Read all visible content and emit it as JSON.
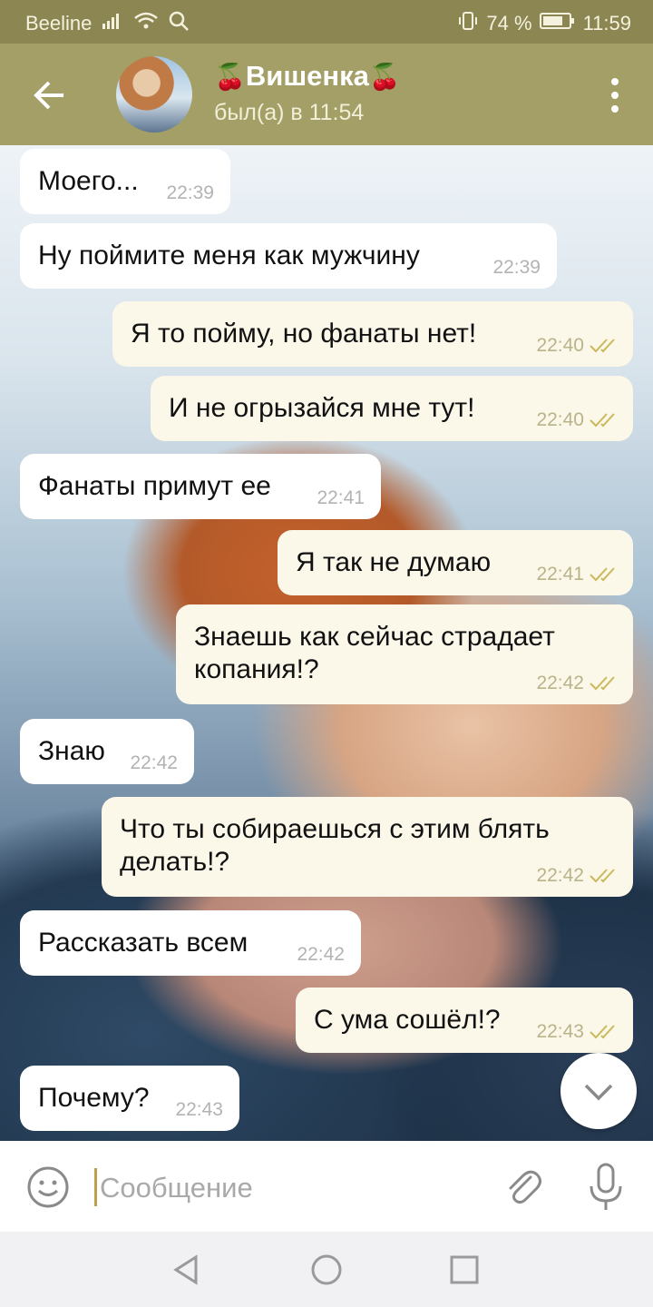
{
  "status_bar": {
    "carrier": "Beeline",
    "battery": "74 %",
    "time": "11:59",
    "icons": [
      "signal-icon",
      "wifi-icon",
      "search-icon",
      "vibrate-icon",
      "battery-icon"
    ]
  },
  "header": {
    "name": "Вишенка",
    "name_decoration": "🍒",
    "last_seen": "был(а) в 11:54",
    "icons": [
      "back-arrow-icon",
      "avatar",
      "more-vert-icon"
    ]
  },
  "messages": [
    {
      "dir": "in",
      "lines": [
        "Моего..."
      ],
      "time": "22:39"
    },
    {
      "dir": "in",
      "lines": [
        "Ну поймите меня как мужчину"
      ],
      "time": "22:39"
    },
    {
      "dir": "out",
      "lines": [
        "Я то пойму, но фанаты нет!"
      ],
      "time": "22:40",
      "read": true
    },
    {
      "dir": "out",
      "lines": [
        "И не огрызайся мне тут!"
      ],
      "time": "22:40",
      "read": true
    },
    {
      "dir": "in",
      "lines": [
        "Фанаты примут ее"
      ],
      "time": "22:41"
    },
    {
      "dir": "out",
      "lines": [
        "Я так не думаю"
      ],
      "time": "22:41",
      "read": true
    },
    {
      "dir": "out",
      "lines": [
        "Знаешь как сейчас страдает",
        "копания!?"
      ],
      "time": "22:42",
      "read": true
    },
    {
      "dir": "in",
      "lines": [
        "Знаю"
      ],
      "time": "22:42"
    },
    {
      "dir": "out",
      "lines": [
        "Что ты собираешься с этим блять",
        "делать!?"
      ],
      "time": "22:42",
      "read": true
    },
    {
      "dir": "in",
      "lines": [
        "Рассказать всем"
      ],
      "time": "22:42"
    },
    {
      "dir": "out",
      "lines": [
        "С ума сошёл!?"
      ],
      "time": "22:43",
      "read": true
    },
    {
      "dir": "in",
      "lines": [
        "Почему?"
      ],
      "time": "22:43"
    }
  ],
  "input": {
    "placeholder": "Сообщение",
    "value": ""
  },
  "colors": {
    "app_bar": "#a39f66",
    "status_bar": "#8c8752",
    "bubble_in": "#ffffff",
    "bubble_out": "#fbf8ea",
    "read_check": "#c9b95a"
  },
  "nav_bar": {
    "icons": [
      "back-triangle-icon",
      "home-circle-icon",
      "recents-square-icon"
    ]
  }
}
